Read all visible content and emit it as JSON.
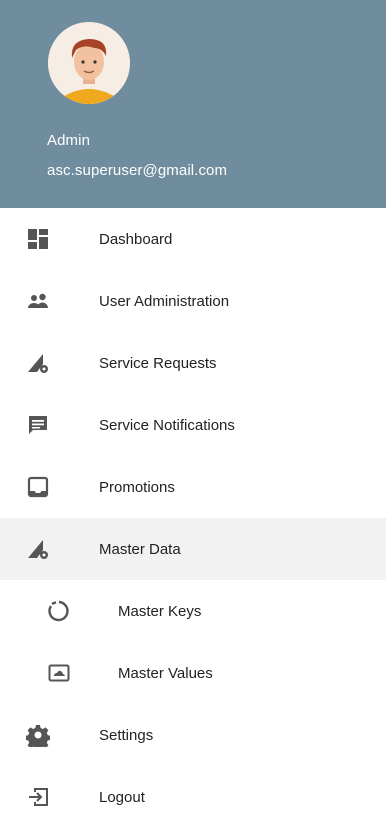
{
  "header": {
    "name": "Admin",
    "email": "asc.superuser@gmail.com",
    "colors": {
      "background": "#6f8d9e",
      "text": "#ffffff"
    }
  },
  "menu": {
    "items": [
      {
        "label": "Dashboard",
        "icon": "dashboard-icon"
      },
      {
        "label": "User Administration",
        "icon": "people-icon"
      },
      {
        "label": "Service Requests",
        "icon": "wrench-gear-icon"
      },
      {
        "label": "Service Notifications",
        "icon": "message-icon"
      },
      {
        "label": "Promotions",
        "icon": "inbox-icon"
      },
      {
        "label": "Master Data",
        "icon": "wrench-gear-icon",
        "active": true
      },
      {
        "label": "Master Keys",
        "icon": "loading-circle-icon",
        "submenu": true
      },
      {
        "label": "Master Values",
        "icon": "cloud-box-icon",
        "submenu": true
      },
      {
        "label": "Settings",
        "icon": "gear-icon"
      },
      {
        "label": "Logout",
        "icon": "logout-icon"
      }
    ],
    "colors": {
      "icon": "#555555",
      "active_background": "#f2f2f2"
    }
  }
}
